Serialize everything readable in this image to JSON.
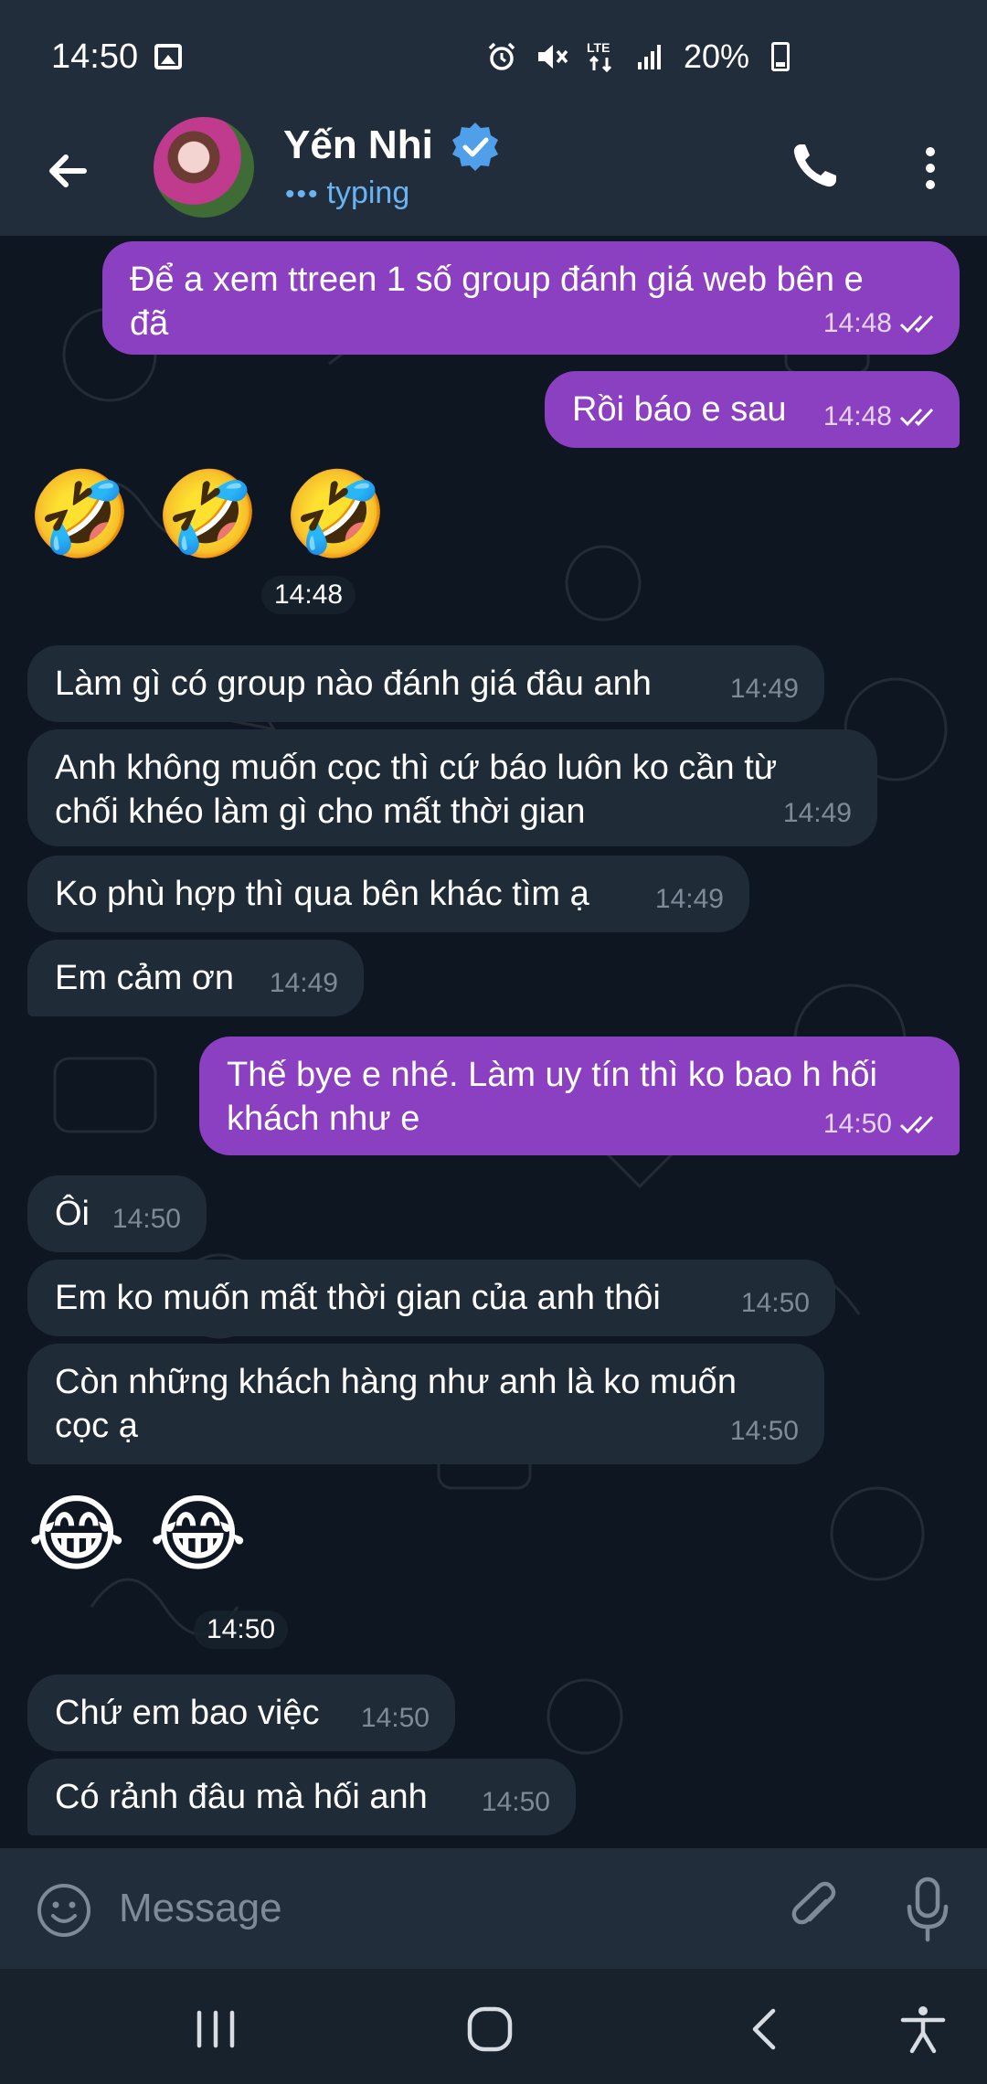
{
  "status_bar": {
    "time": "14:50",
    "network": "LTE",
    "battery": "20%"
  },
  "header": {
    "contact_name": "Yến Nhi",
    "status": "typing",
    "avatar": "contact-avatar-photo"
  },
  "messages": [
    {
      "dir": "out",
      "text_lines": [
        "Để a xem ttreen 1 số group đánh giá web bên e",
        "đã"
      ],
      "time": "14:48",
      "read": true
    },
    {
      "dir": "out",
      "text_lines": [
        "Rồi báo e sau"
      ],
      "time": "14:48",
      "read": true
    },
    {
      "dir": "in",
      "emoji": "🤣 🤣 🤣",
      "time": "14:48"
    },
    {
      "dir": "in",
      "text_lines": [
        "Làm gì có group nào đánh giá đâu anh"
      ],
      "time": "14:49"
    },
    {
      "dir": "in",
      "text_lines": [
        "Anh không muốn cọc thì cứ báo luôn ko cần từ",
        "chối khéo làm gì cho mất thời gian"
      ],
      "time": "14:49"
    },
    {
      "dir": "in",
      "text_lines": [
        "Ko phù hợp thì qua bên khác tìm ạ"
      ],
      "time": "14:49"
    },
    {
      "dir": "in",
      "text_lines": [
        "Em cảm ơn"
      ],
      "time": "14:49"
    },
    {
      "dir": "out",
      "text_lines": [
        "Thế bye e nhé. Làm uy tín thì ko bao h hối",
        "khách như e"
      ],
      "time": "14:50",
      "read": true
    },
    {
      "dir": "in",
      "text_lines": [
        "Ôi"
      ],
      "time": "14:50"
    },
    {
      "dir": "in",
      "text_lines": [
        "Em ko muốn mất thời gian của anh thôi"
      ],
      "time": "14:50"
    },
    {
      "dir": "in",
      "text_lines": [
        "Còn những khách hàng như anh là ko muốn",
        "cọc ạ"
      ],
      "time": "14:50"
    },
    {
      "dir": "in",
      "emoji": "😂 😂",
      "time": "14:50"
    },
    {
      "dir": "in",
      "text_lines": [
        "Chứ em bao việc"
      ],
      "time": "14:50"
    },
    {
      "dir": "in",
      "text_lines": [
        "Có rảnh đâu mà hối anh"
      ],
      "time": "14:50"
    }
  ],
  "input": {
    "placeholder": "Message"
  },
  "colors": {
    "outgoing_bubble": "#8b3fc1",
    "incoming_bubble": "#1f2c38",
    "header_bg": "#212d3b",
    "chat_bg": "#0e1621",
    "typing_accent": "#6ab3f3",
    "verified_badge": "#4f9fea"
  },
  "icons": {
    "back": "arrow-left-icon",
    "verified": "verified-badge-icon",
    "call": "phone-icon",
    "menu": "more-vertical-icon",
    "emoji": "smiley-icon",
    "attach": "paperclip-icon",
    "mic": "microphone-icon",
    "nav_recents": "recents-icon",
    "nav_home": "home-icon",
    "nav_back": "back-chevron-icon",
    "nav_accessibility": "accessibility-icon"
  }
}
